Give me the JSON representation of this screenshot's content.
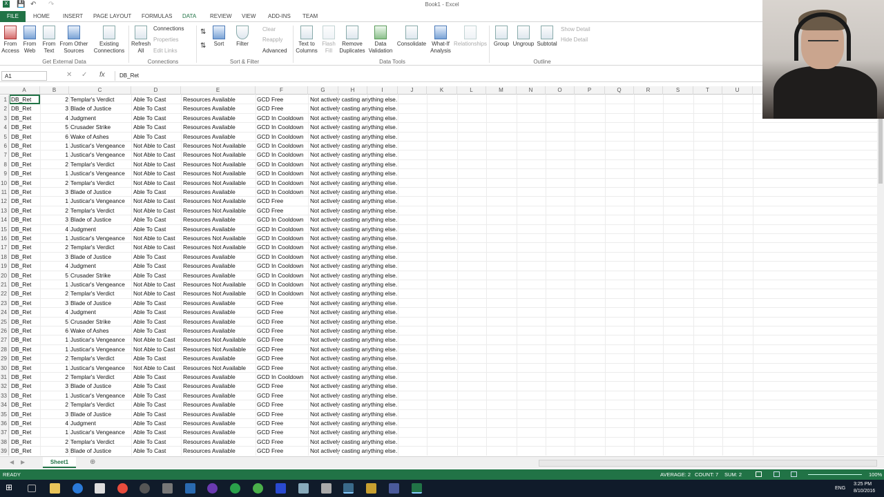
{
  "window": {
    "title": "Book1 - Excel"
  },
  "tabs": {
    "file": "FILE",
    "home": "HOME",
    "insert": "INSERT",
    "page_layout": "PAGE LAYOUT",
    "formulas": "FORMULAS",
    "data": "DATA",
    "review": "REVIEW",
    "view": "VIEW",
    "addins": "ADD-INS",
    "team": "TEAM"
  },
  "ribbon": {
    "from_access": "From Access",
    "from_web": "From Web",
    "from_text": "From Text",
    "from_other": "From Other Sources",
    "existing_connections": "Existing Connections",
    "get_external_data": "Get External Data",
    "refresh_all": "Refresh All",
    "connections": "Connections",
    "properties": "Properties",
    "edit_links": "Edit Links",
    "connections_group": "Connections",
    "sort": "Sort",
    "filter": "Filter",
    "clear": "Clear",
    "reapply": "Reapply",
    "advanced": "Advanced",
    "sort_filter_group": "Sort & Filter",
    "text_to_columns": "Text to Columns",
    "flash_fill": "Flash Fill",
    "remove_duplicates": "Remove Duplicates",
    "data_validation": "Data Validation",
    "consolidate": "Consolidate",
    "what_if": "What-If Analysis",
    "relationships": "Relationships",
    "data_tools_group": "Data Tools",
    "group": "Group",
    "ungroup": "Ungroup",
    "subtotal": "Subtotal",
    "show_detail": "Show Detail",
    "hide_detail": "Hide Detail",
    "outline_group": "Outline"
  },
  "formula_bar": {
    "name_box": "A1",
    "formula": "DB_Ret"
  },
  "columns": [
    "A",
    "B",
    "C",
    "D",
    "E",
    "F",
    "G",
    "H",
    "I",
    "J",
    "K",
    "L",
    "M",
    "N",
    "O",
    "P",
    "Q",
    "R",
    "S",
    "T",
    "U"
  ],
  "rows": [
    [
      "1",
      "DB_Ret",
      "2",
      "Templar's Verdict",
      "Able To Cast",
      "Resources Available",
      "GCD Free",
      "Not actively casting anything else."
    ],
    [
      "2",
      "DB_Ret",
      "3",
      "Blade of Justice",
      "Able To Cast",
      "Resources Available",
      "GCD Free",
      "Not actively casting anything else."
    ],
    [
      "3",
      "DB_Ret",
      "4",
      "Judgment",
      "Able To Cast",
      "Resources Available",
      "GCD In Cooldown",
      "Not actively casting anything else."
    ],
    [
      "4",
      "DB_Ret",
      "5",
      "Crusader Strike",
      "Able To Cast",
      "Resources Available",
      "GCD In Cooldown",
      "Not actively casting anything else."
    ],
    [
      "5",
      "DB_Ret",
      "6",
      "Wake of Ashes",
      "Able To Cast",
      "Resources Available",
      "GCD In Cooldown",
      "Not actively casting anything else."
    ],
    [
      "6",
      "DB_Ret",
      "1",
      "Justicar's Vengeance",
      "Not Able to Cast",
      "Resources Not Available",
      "GCD In Cooldown",
      "Not actively casting anything else."
    ],
    [
      "7",
      "DB_Ret",
      "1",
      "Justicar's Vengeance",
      "Not Able to Cast",
      "Resources Not Available",
      "GCD In Cooldown",
      "Not actively casting anything else."
    ],
    [
      "8",
      "DB_Ret",
      "2",
      "Templar's Verdict",
      "Not Able to Cast",
      "Resources Not Available",
      "GCD In Cooldown",
      "Not actively casting anything else."
    ],
    [
      "9",
      "DB_Ret",
      "1",
      "Justicar's Vengeance",
      "Not Able to Cast",
      "Resources Not Available",
      "GCD In Cooldown",
      "Not actively casting anything else."
    ],
    [
      "10",
      "DB_Ret",
      "2",
      "Templar's Verdict",
      "Not Able to Cast",
      "Resources Not Available",
      "GCD In Cooldown",
      "Not actively casting anything else."
    ],
    [
      "11",
      "DB_Ret",
      "3",
      "Blade of Justice",
      "Able To Cast",
      "Resources Available",
      "GCD In Cooldown",
      "Not actively casting anything else."
    ],
    [
      "12",
      "DB_Ret",
      "1",
      "Justicar's Vengeance",
      "Not Able to Cast",
      "Resources Not Available",
      "GCD Free",
      "Not actively casting anything else."
    ],
    [
      "13",
      "DB_Ret",
      "2",
      "Templar's Verdict",
      "Not Able to Cast",
      "Resources Not Available",
      "GCD Free",
      "Not actively casting anything else."
    ],
    [
      "14",
      "DB_Ret",
      "3",
      "Blade of Justice",
      "Able To Cast",
      "Resources Available",
      "GCD In Cooldown",
      "Not actively casting anything else."
    ],
    [
      "15",
      "DB_Ret",
      "4",
      "Judgment",
      "Able To Cast",
      "Resources Available",
      "GCD In Cooldown",
      "Not actively casting anything else."
    ],
    [
      "16",
      "DB_Ret",
      "1",
      "Justicar's Vengeance",
      "Not Able to Cast",
      "Resources Not Available",
      "GCD In Cooldown",
      "Not actively casting anything else."
    ],
    [
      "17",
      "DB_Ret",
      "2",
      "Templar's Verdict",
      "Not Able to Cast",
      "Resources Not Available",
      "GCD In Cooldown",
      "Not actively casting anything else."
    ],
    [
      "18",
      "DB_Ret",
      "3",
      "Blade of Justice",
      "Able To Cast",
      "Resources Available",
      "GCD In Cooldown",
      "Not actively casting anything else."
    ],
    [
      "19",
      "DB_Ret",
      "4",
      "Judgment",
      "Able To Cast",
      "Resources Available",
      "GCD In Cooldown",
      "Not actively casting anything else."
    ],
    [
      "20",
      "DB_Ret",
      "5",
      "Crusader Strike",
      "Able To Cast",
      "Resources Available",
      "GCD In Cooldown",
      "Not actively casting anything else."
    ],
    [
      "21",
      "DB_Ret",
      "1",
      "Justicar's Vengeance",
      "Not Able to Cast",
      "Resources Not Available",
      "GCD In Cooldown",
      "Not actively casting anything else."
    ],
    [
      "22",
      "DB_Ret",
      "2",
      "Templar's Verdict",
      "Not Able to Cast",
      "Resources Not Available",
      "GCD In Cooldown",
      "Not actively casting anything else."
    ],
    [
      "23",
      "DB_Ret",
      "3",
      "Blade of Justice",
      "Able To Cast",
      "Resources Available",
      "GCD Free",
      "Not actively casting anything else."
    ],
    [
      "24",
      "DB_Ret",
      "4",
      "Judgment",
      "Able To Cast",
      "Resources Available",
      "GCD Free",
      "Not actively casting anything else."
    ],
    [
      "25",
      "DB_Ret",
      "5",
      "Crusader Strike",
      "Able To Cast",
      "Resources Available",
      "GCD Free",
      "Not actively casting anything else."
    ],
    [
      "26",
      "DB_Ret",
      "6",
      "Wake of Ashes",
      "Able To Cast",
      "Resources Available",
      "GCD Free",
      "Not actively casting anything else."
    ],
    [
      "27",
      "DB_Ret",
      "1",
      "Justicar's Vengeance",
      "Not Able to Cast",
      "Resources Not Available",
      "GCD Free",
      "Not actively casting anything else."
    ],
    [
      "28",
      "DB_Ret",
      "1",
      "Justicar's Vengeance",
      "Not Able to Cast",
      "Resources Not Available",
      "GCD Free",
      "Not actively casting anything else."
    ],
    [
      "29",
      "DB_Ret",
      "2",
      "Templar's Verdict",
      "Able To Cast",
      "Resources Available",
      "GCD Free",
      "Not actively casting anything else."
    ],
    [
      "30",
      "DB_Ret",
      "1",
      "Justicar's Vengeance",
      "Not Able to Cast",
      "Resources Not Available",
      "GCD Free",
      "Not actively casting anything else."
    ],
    [
      "31",
      "DB_Ret",
      "2",
      "Templar's Verdict",
      "Able To Cast",
      "Resources Available",
      "GCD In Cooldown",
      "Not actively casting anything else."
    ],
    [
      "32",
      "DB_Ret",
      "3",
      "Blade of Justice",
      "Able To Cast",
      "Resources Available",
      "GCD Free",
      "Not actively casting anything else."
    ],
    [
      "33",
      "DB_Ret",
      "1",
      "Justicar's Vengeance",
      "Able To Cast",
      "Resources Available",
      "GCD Free",
      "Not actively casting anything else."
    ],
    [
      "34",
      "DB_Ret",
      "2",
      "Templar's Verdict",
      "Able To Cast",
      "Resources Available",
      "GCD Free",
      "Not actively casting anything else."
    ],
    [
      "35",
      "DB_Ret",
      "3",
      "Blade of Justice",
      "Able To Cast",
      "Resources Available",
      "GCD Free",
      "Not actively casting anything else."
    ],
    [
      "36",
      "DB_Ret",
      "4",
      "Judgment",
      "Able To Cast",
      "Resources Available",
      "GCD Free",
      "Not actively casting anything else."
    ],
    [
      "37",
      "DB_Ret",
      "1",
      "Justicar's Vengeance",
      "Able To Cast",
      "Resources Available",
      "GCD Free",
      "Not actively casting anything else."
    ],
    [
      "38",
      "DB_Ret",
      "2",
      "Templar's Verdict",
      "Able To Cast",
      "Resources Available",
      "GCD Free",
      "Not actively casting anything else."
    ],
    [
      "39",
      "DB_Ret",
      "3",
      "Blade of Justice",
      "Able To Cast",
      "Resources Available",
      "GCD Free",
      "Not actively casting anything else."
    ]
  ],
  "sheet_tabs": [
    "Sheet1"
  ],
  "status": {
    "ready": "READY",
    "average": "AVERAGE: 2",
    "count": "COUNT: 7",
    "sum": "SUM: 2",
    "zoom": "100%"
  },
  "taskbar": {
    "lang": "ENG",
    "time": "3:25 PM",
    "date": "8/10/2016"
  },
  "colors": {
    "excel_green": "#217346",
    "taskbar": "#101b2a"
  }
}
